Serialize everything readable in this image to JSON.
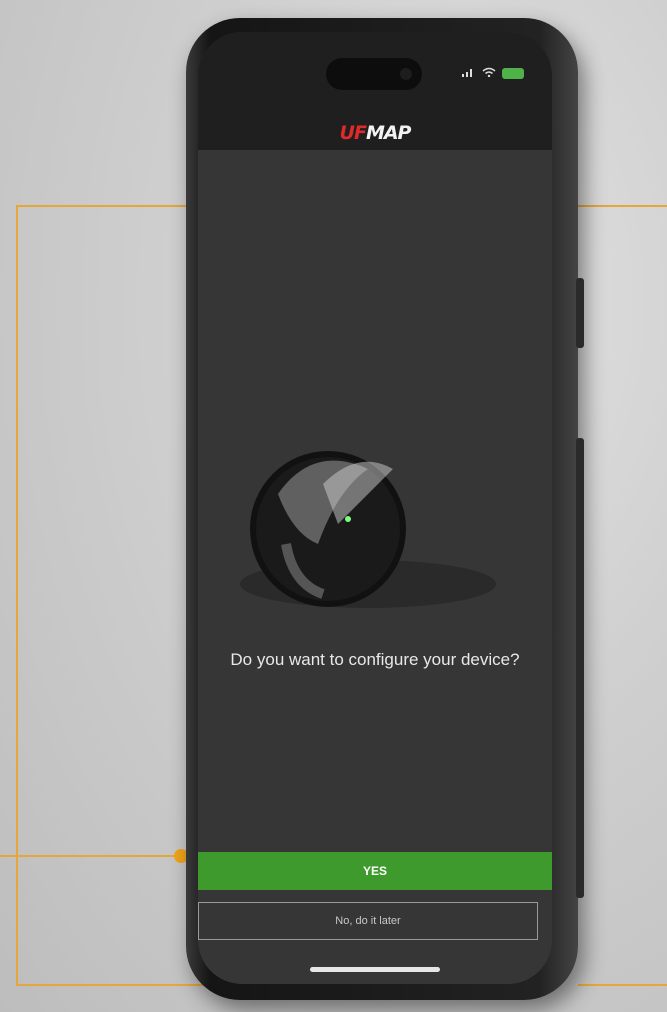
{
  "app": {
    "logo_part1": "UF",
    "logo_part2": "MAP"
  },
  "status_bar": {
    "signal_icon": "signal-icon",
    "wifi_icon": "wifi-icon",
    "battery_icon": "battery-icon"
  },
  "prompt": {
    "question": "Do you want to configure your device?"
  },
  "actions": {
    "yes_label": "YES",
    "later_label": "No, do it later"
  },
  "device": {
    "image": "tracker-device"
  },
  "colors": {
    "accent": "#3e9a2d",
    "frame_line": "#e6a73a",
    "brand_red": "#e02a2a"
  }
}
